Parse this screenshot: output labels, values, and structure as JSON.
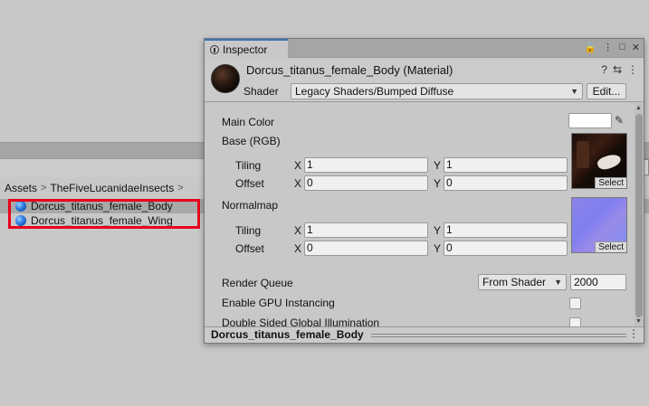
{
  "project": {
    "breadcrumb": [
      "Assets",
      "TheFiveLucanidaeInsects"
    ],
    "breadcrumb_sep": ">",
    "assets": [
      {
        "name": "Dorcus_titanus_female_Body",
        "selected": true
      },
      {
        "name": "Dorcus_titanus_female_Wing",
        "selected": false
      }
    ]
  },
  "inspector": {
    "tab_label": "Inspector",
    "tab_actions": {
      "lock": "🔒",
      "menu": "⋮",
      "maximize": "□",
      "close": "✕"
    },
    "material_title": "Dorcus_titanus_female_Body (Material)",
    "header_icons": {
      "help": "?",
      "presets": "⇆",
      "menu": "⋮"
    },
    "shader_label": "Shader",
    "shader_value": "Legacy Shaders/Bumped Diffuse",
    "edit_button": "Edit...",
    "properties": {
      "main_color_label": "Main Color",
      "base_label": "Base (RGB)",
      "normalmap_label": "Normalmap",
      "tiling_label": "Tiling",
      "offset_label": "Offset",
      "axis_x": "X",
      "axis_y": "Y",
      "base_tiling": {
        "x": "1",
        "y": "1"
      },
      "base_offset": {
        "x": "0",
        "y": "0"
      },
      "normal_tiling": {
        "x": "1",
        "y": "1"
      },
      "normal_offset": {
        "x": "0",
        "y": "0"
      },
      "select_label": "Select",
      "render_queue_label": "Render Queue",
      "render_queue_mode": "From Shader",
      "render_queue_value": "2000",
      "gpu_instancing_label": "Enable GPU Instancing",
      "gpu_instancing_checked": false,
      "double_sided_label": "Double Sided Global Illumination",
      "double_sided_checked": false
    },
    "footer_name": "Dorcus_titanus_female_Body"
  },
  "colors": {
    "selection_outline": "#e8001c",
    "tab_accent": "#3a72b0",
    "main_color_swatch": "#ffffff"
  }
}
